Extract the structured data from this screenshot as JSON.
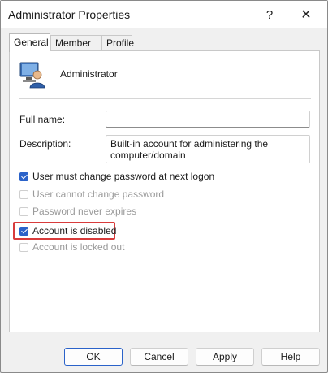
{
  "window": {
    "title": "Administrator Properties"
  },
  "titlebar": {
    "help_glyph": "?",
    "close_glyph": "✕"
  },
  "tabs": [
    {
      "label": "General",
      "active": true
    },
    {
      "label": "Member Of",
      "active": false
    },
    {
      "label": "Profile",
      "active": false
    }
  ],
  "user": {
    "name": "Administrator",
    "icon": "user-computer-icon"
  },
  "fields": {
    "full_name": {
      "label": "Full name:",
      "value": ""
    },
    "description": {
      "label": "Description:",
      "value": "Built-in account for administering the computer/domain"
    }
  },
  "checkboxes": [
    {
      "label": "User must change password at next logon",
      "checked": true,
      "enabled": true
    },
    {
      "label": "User cannot change password",
      "checked": false,
      "enabled": false
    },
    {
      "label": "Password never expires",
      "checked": false,
      "enabled": false
    },
    {
      "label": "Account is disabled",
      "checked": true,
      "enabled": true
    },
    {
      "label": "Account is locked out",
      "checked": false,
      "enabled": false
    }
  ],
  "buttons": {
    "ok": "OK",
    "cancel": "Cancel",
    "apply": "Apply",
    "help": "Help"
  },
  "colors": {
    "accent": "#2a62c9",
    "highlight": "#d83b3b"
  }
}
